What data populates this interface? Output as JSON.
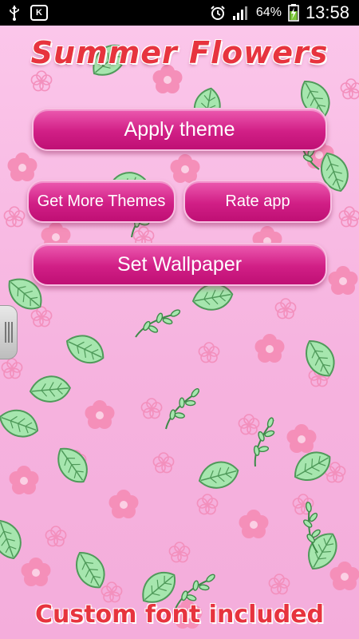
{
  "status_bar": {
    "left_icons": [
      "usb-icon",
      "keyboard-k-icon"
    ],
    "keyboard_badge": "K",
    "battery_percent": "64%",
    "time": "13:58",
    "right_icons": [
      "alarm-clock-icon",
      "signal-icon",
      "battery-charging-icon"
    ]
  },
  "app": {
    "title": "Summer Flowers",
    "footer_text": "Custom font included"
  },
  "buttons": {
    "apply_theme": "Apply theme",
    "get_more_themes": "Get More Themes",
    "rate_app": "Rate app",
    "set_wallpaper": "Set Wallpaper"
  },
  "colors": {
    "title_red": "#e7343e",
    "button_pink": "#d11f86",
    "background_pink": "#f7b8e2",
    "leaf_green": "#9fe0a8"
  }
}
